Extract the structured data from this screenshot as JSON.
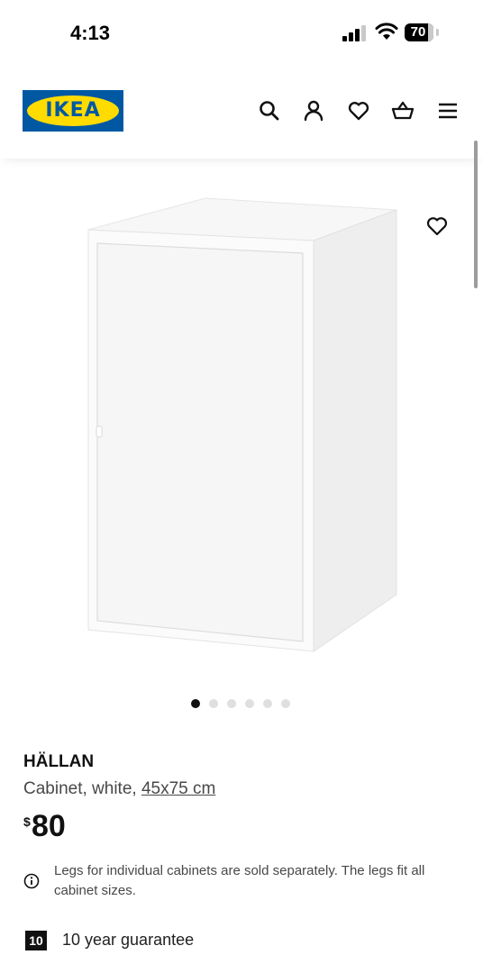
{
  "status_bar": {
    "time": "4:13",
    "battery": "70"
  },
  "header": {
    "logo_text": "IKEA",
    "icons": [
      "search-icon",
      "account-icon",
      "heart-icon",
      "cart-icon",
      "menu-icon"
    ]
  },
  "gallery": {
    "total_images": 6,
    "active_index": 0
  },
  "product": {
    "name": "HÄLLAN",
    "description": "Cabinet, white, ",
    "dimensions": "45x75 cm",
    "currency": "$",
    "price": "80",
    "note": "Legs for individual cabinets are sold separately. The legs fit all cabinet sizes.",
    "guarantee_years": "10",
    "guarantee_text": "10 year guarantee"
  },
  "colors": {
    "ikea_blue": "#0058a3",
    "ikea_yellow": "#ffdb00"
  }
}
